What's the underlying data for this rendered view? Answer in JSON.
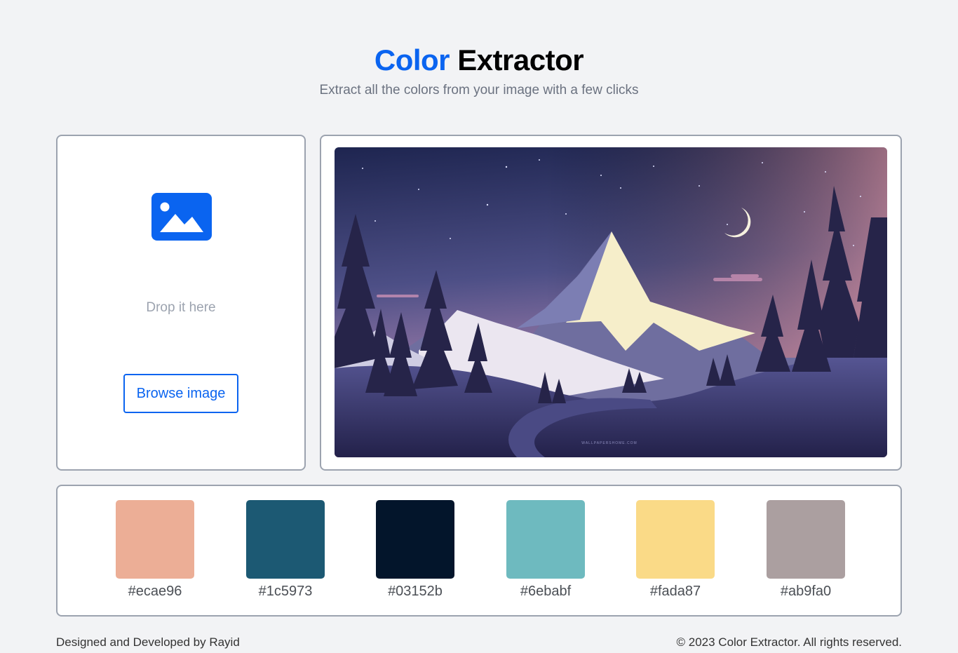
{
  "header": {
    "title_accent": "Color",
    "title_rest": "Extractor",
    "subtitle": "Extract all the colors from your image with a few clicks"
  },
  "upload": {
    "icon": "image-icon",
    "drop_text": "Drop it here",
    "browse_label": "Browse image"
  },
  "preview": {
    "watermark": "WALLPAPERSHOME.COM"
  },
  "palette": {
    "colors": [
      {
        "hex": "#ecae96"
      },
      {
        "hex": "#1c5973"
      },
      {
        "hex": "#03152b"
      },
      {
        "hex": "#6ebabf"
      },
      {
        "hex": "#fada87"
      },
      {
        "hex": "#ab9fa0"
      }
    ]
  },
  "footer": {
    "credit": "Designed and Developed by Rayid",
    "copyright": "© 2023 Color Extractor. All rights reserved."
  },
  "theme": {
    "accent": "#0a64f0",
    "background": "#f2f3f5"
  }
}
